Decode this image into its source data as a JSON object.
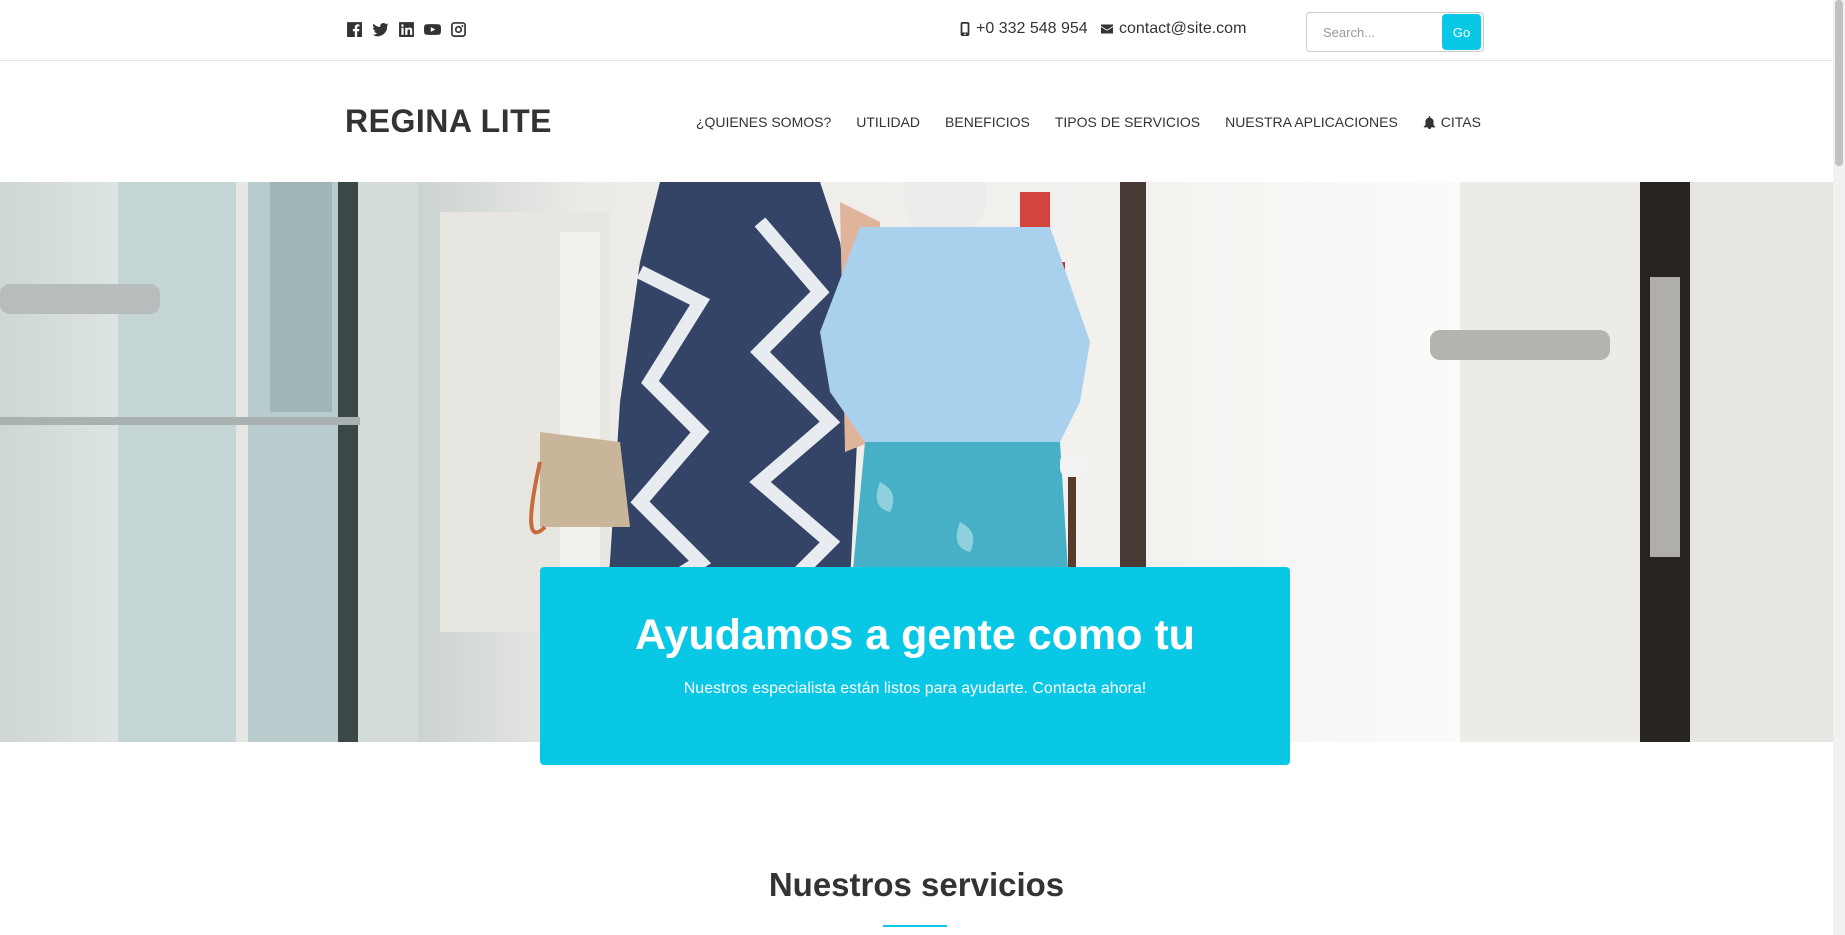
{
  "topbar": {
    "social": [
      {
        "name": "facebook-icon"
      },
      {
        "name": "twitter-icon"
      },
      {
        "name": "linkedin-icon"
      },
      {
        "name": "youtube-icon"
      },
      {
        "name": "instagram-icon"
      }
    ],
    "phone": "+0 332 548 954",
    "email": "contact@site.com",
    "search": {
      "placeholder": "Search...",
      "button_label": "Go"
    }
  },
  "header": {
    "logo": "REGINA LITE",
    "nav": [
      {
        "label": "¿QUIENES SOMOS?"
      },
      {
        "label": "UTILIDAD"
      },
      {
        "label": "BENEFICIOS"
      },
      {
        "label": "TIPOS DE SERVICIOS"
      },
      {
        "label": "NUESTRA APLICACIONES"
      },
      {
        "label": "CITAS",
        "icon": "bell-icon"
      }
    ]
  },
  "hero": {
    "title": "Ayudamos a gente como tu",
    "subtitle": "Nuestros especialista están listos para ayudarte. Contacta ahora!"
  },
  "services": {
    "title": "Nuestros servicios"
  },
  "colors": {
    "accent": "#08c8e6",
    "text": "#333333"
  }
}
